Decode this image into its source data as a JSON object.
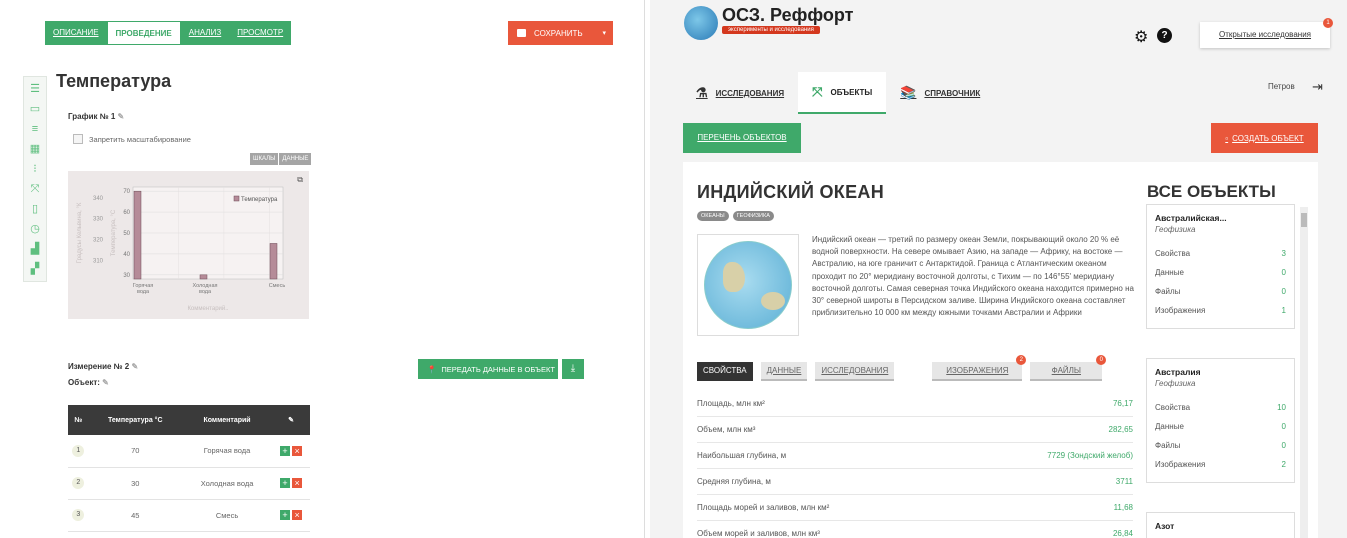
{
  "left": {
    "tabs": [
      {
        "label": "ОПИСАНИЕ"
      },
      {
        "label": "ПРОВЕДЕНИЕ"
      },
      {
        "label": "АНАЛИЗ"
      },
      {
        "label": "ПРОСМОТР"
      }
    ],
    "save_label": "СОХРАНИТЬ",
    "title": "Температура",
    "graph_label": "График № 1",
    "zoom_label": "Запретить масштабирование",
    "chart_tabs": [
      "ШКАЛЫ",
      "ДАННЫЕ"
    ],
    "measurement_label": "Измерение № 2",
    "object_label": "Объект:",
    "transfer_label": "ПЕРЕДАТЬ ДАННЫЕ В ОБЪЕКТ",
    "table": {
      "headers": [
        "№",
        "Температура °С",
        "Комментарий"
      ],
      "rows": [
        {
          "num": "1",
          "temp": "70",
          "comment": "Горячая вода"
        },
        {
          "num": "2",
          "temp": "30",
          "comment": "Холодная вода"
        },
        {
          "num": "3",
          "temp": "45",
          "comment": "Смесь"
        }
      ]
    }
  },
  "chart_data": {
    "type": "bar",
    "categories": [
      "Горячая вода",
      "Холодная вода",
      "Смесь"
    ],
    "series": [
      {
        "name": "Температура",
        "values": [
          70,
          30,
          45
        ]
      }
    ],
    "ylim": [
      28,
      72
    ],
    "yticks": [
      "30",
      "40",
      "50",
      "60",
      "70"
    ],
    "secondary_yticks": [
      "310",
      "320",
      "330",
      "340"
    ],
    "xlabel": "Комментарий",
    "ylabel": "Температура, °С",
    "secondary_ylabel": "Градусы Кельвина, °К",
    "legend": "top-right",
    "bar_color": "#b58b98"
  },
  "right": {
    "app_title": "ОСЗ. Реффорт",
    "app_subtitle": "эксперименты и исследования",
    "open_studies_label": "Открытые исследования",
    "open_studies_count": "1",
    "nav": [
      {
        "label": "ИССЛЕДОВАНИЯ",
        "icon": "flask-icon"
      },
      {
        "label": "ОБЪЕКТЫ",
        "icon": "objects-icon"
      },
      {
        "label": "СПРАВОЧНИК",
        "icon": "book-icon"
      }
    ],
    "user_name": "Петров",
    "list_objects_label": "ПЕРЕЧЕНЬ ОБЪЕКТОВ",
    "create_object_label": "СОЗДАТЬ ОБЪЕКТ",
    "object": {
      "title": "ИНДИЙСКИЙ ОКЕАН",
      "tags": [
        "ОКЕАНЫ",
        "ГЕОФИЗИКА"
      ],
      "description": "Индийский океан — третий по размеру океан Земли, покрывающий около 20 % её водной поверхности. На севере омывает Азию, на западе — Африку, на востоке — Австралию, на юге граничит с Антарктидой. Граница с Атлантическим океаном проходит по 20° меридиану восточной долготы, с Тихим — по 146°55' меридиану восточной долготы. Самая северная точка Индийского океана находится примерно на 30° северной широты в Персидском заливе. Ширина Индийского океана составляет приблизительно 10 000 км между южными точками Австралии и Африки",
      "tabs": [
        "СВОЙСТВА",
        "ДАННЫЕ",
        "ИССЛЕДОВАНИЯ",
        "ИЗОБРАЖЕНИЯ",
        "ФАЙЛЫ"
      ],
      "images_count": "2",
      "files_count": "0",
      "properties": [
        {
          "name": "Площадь, млн км²",
          "value": "76,17"
        },
        {
          "name": "Объем, млн км³",
          "value": "282,65"
        },
        {
          "name": "Наибольшая глубина, м",
          "value": "7729 (Зондский желоб)"
        },
        {
          "name": "Средняя глубина, м",
          "value": "3711"
        },
        {
          "name": "Площадь морей и заливов, млн км²",
          "value": "11,68"
        },
        {
          "name": "Объем морей и заливов, млн км³",
          "value": "26,84"
        }
      ]
    },
    "all_objects_title": "ВСЕ ОБЪЕКТЫ",
    "stat_labels": [
      "Свойства",
      "Данные",
      "Файлы",
      "Изображения"
    ],
    "object_cards": [
      {
        "name": "Австралийская...",
        "category": "Геофизика",
        "stats": [
          "3",
          "0",
          "0",
          "1"
        ]
      },
      {
        "name": "Австралия",
        "category": "Геофизика",
        "stats": [
          "10",
          "0",
          "0",
          "2"
        ]
      },
      {
        "name": "Азот",
        "category": "",
        "stats": []
      }
    ]
  }
}
